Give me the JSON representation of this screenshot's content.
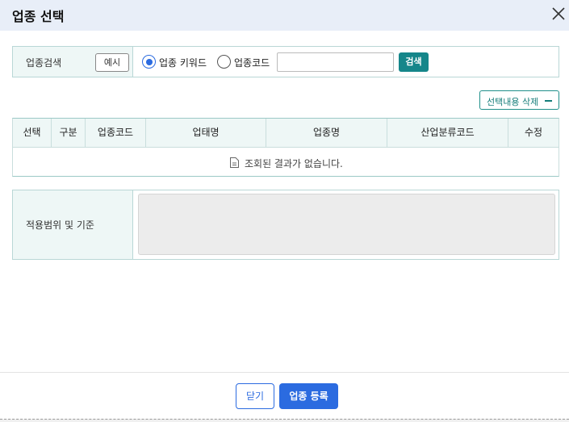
{
  "dialog": {
    "title": "업종 선택",
    "close_icon": "close-icon"
  },
  "search": {
    "label": "업종검색",
    "example_button": "예시",
    "options": [
      {
        "label": "업종 키워드",
        "selected": true
      },
      {
        "label": "업종코드",
        "selected": false
      }
    ],
    "input_value": "",
    "input_placeholder": "",
    "search_button": "검색"
  },
  "delete_selection_button": "선택내용 삭제",
  "table": {
    "columns": [
      "선택",
      "구분",
      "업종코드",
      "업태명",
      "업종명",
      "산업분류코드",
      "수정"
    ],
    "empty_message": "조회된 결과가 없습니다.",
    "empty_icon": "document-icon"
  },
  "scope": {
    "label": "적용범위 및 기준",
    "content": ""
  },
  "footer": {
    "close_button": "닫기",
    "register_button": "업종 등록"
  },
  "colors": {
    "header_bg": "#e8eef8",
    "teal_accent": "#15868a",
    "primary_blue": "#2b6be0",
    "label_bg": "#eef7f6"
  }
}
